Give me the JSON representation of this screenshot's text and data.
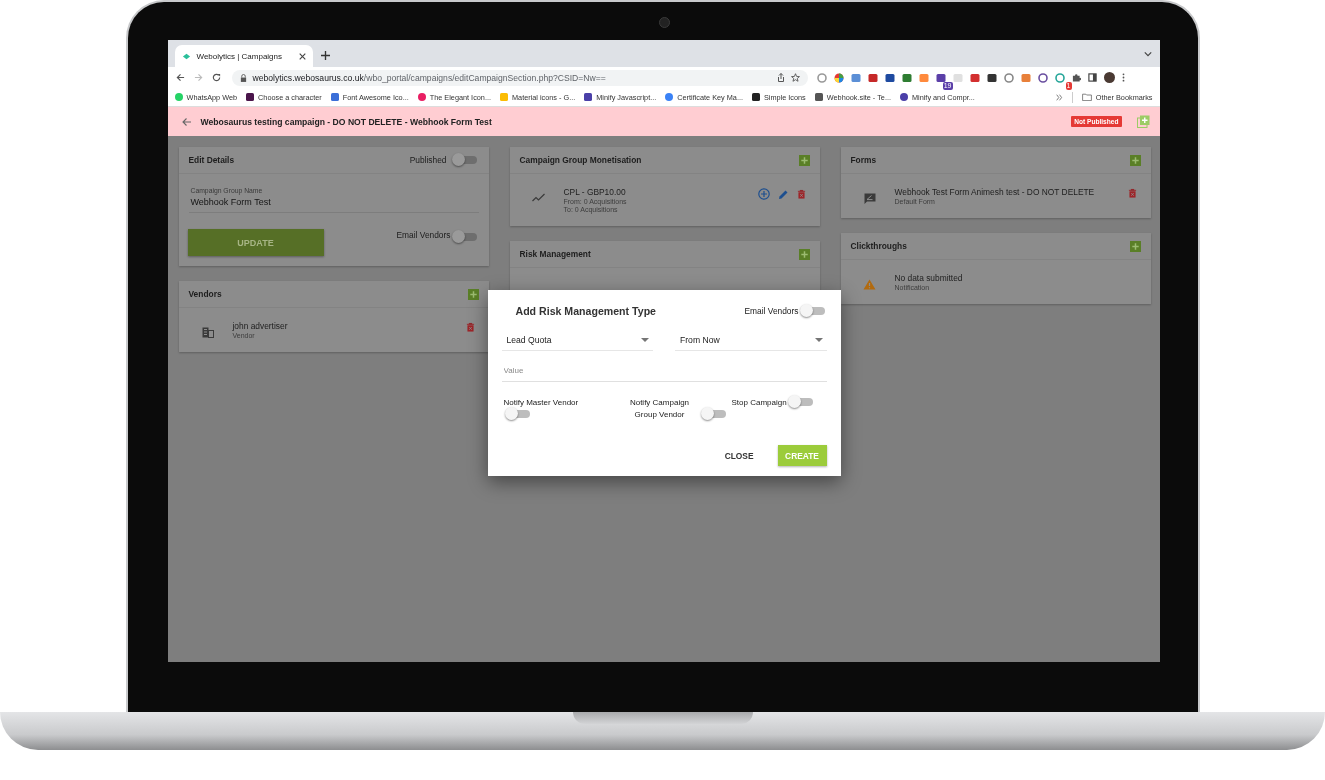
{
  "browser": {
    "tab_title": "Webolytics | Campaigns",
    "url_host": "webolytics.webosaurus.co.uk",
    "url_path": "/wbo_portal/campaigns/editCampaignSection.php?CSID=Nw==",
    "toolbar_badges": [
      "19",
      "1"
    ],
    "bookmarks": [
      "WhatsApp Web",
      "Choose a character",
      "Font Awesome Ico...",
      "The Elegant Icon...",
      "Material icons - G...",
      "Minify Javascript...",
      "Certificate Key Ma...",
      "Simple Icons",
      "Webhook.site - Te...",
      "Minify and Compr..."
    ],
    "other_bookmarks": "Other Bookmarks"
  },
  "header": {
    "title": "Webosaurus testing campaign - DO NOT DELETE - Webhook Form Test",
    "status": "Not Published"
  },
  "columns": [
    [
      {
        "kind": "details",
        "title": "Edit Details",
        "published": {
          "label": "Published",
          "on": false
        },
        "field_label": "Campaign Group Name",
        "field_value": "Webhook Form Test",
        "button": "UPDATE",
        "email_vendors": {
          "label": "Email Vendors",
          "on": false
        }
      },
      {
        "kind": "vendors",
        "title": "Vendors",
        "items": [
          {
            "name": "john advertiser",
            "lines": [
              "Vendor"
            ]
          }
        ]
      }
    ],
    [
      {
        "kind": "monetisation",
        "title": "Campaign Group Monetisation",
        "items": [
          {
            "name": "CPL - GBP10.00",
            "lines": [
              "From: 0 Acquisitions",
              "To: 0 Acquisitions"
            ]
          }
        ]
      },
      {
        "kind": "risk",
        "title": "Risk Management"
      }
    ],
    [
      {
        "kind": "forms",
        "title": "Forms",
        "items": [
          {
            "name": "Webhook Test Form Animesh test - DO NOT DELETE",
            "lines": [
              "Default Form"
            ]
          }
        ]
      },
      {
        "kind": "clickthroughs",
        "title": "Clickthroughs",
        "items": [
          {
            "name": "No data submitted",
            "lines": [
              "Notification"
            ]
          }
        ]
      }
    ]
  ],
  "dialog": {
    "title": "Add Risk Management Type",
    "email_vendors": {
      "label": "Email Vendors",
      "on": false
    },
    "selects": [
      {
        "value": "Lead Quota"
      },
      {
        "value": "From Now"
      }
    ],
    "value_field": {
      "placeholder": "Value"
    },
    "toggles": [
      {
        "label": "Notify Master Vendor",
        "on": false
      },
      {
        "label": "Notify Campaign Group Vendor",
        "on": false
      },
      {
        "label": "Stop Campaign",
        "on": false
      }
    ],
    "buttons": [
      {
        "label": "CLOSE",
        "kind": "text"
      },
      {
        "label": "CREATE",
        "kind": "primary"
      }
    ]
  }
}
